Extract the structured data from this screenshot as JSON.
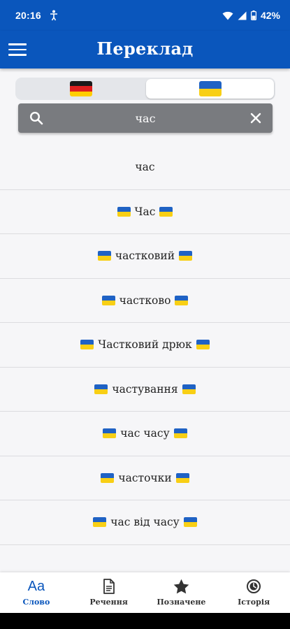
{
  "status_bar": {
    "time": "20:16",
    "battery": "42%"
  },
  "app_bar": {
    "title": "Переклад",
    "menu_icon": "hamburger-menu-icon"
  },
  "language_toggle": {
    "source": {
      "flag": "germany-flag-icon"
    },
    "target": {
      "flag": "ukraine-flag-icon",
      "selected": true
    }
  },
  "search": {
    "value": "час",
    "search_icon": "search-icon",
    "clear_icon": "close-icon"
  },
  "results": [
    {
      "text": "час",
      "flagged": false
    },
    {
      "text": "Час",
      "flagged": true
    },
    {
      "text": "частковий",
      "flagged": true
    },
    {
      "text": "частково",
      "flagged": true
    },
    {
      "text": "Частковий дрюк",
      "flagged": true
    },
    {
      "text": "частування",
      "flagged": true
    },
    {
      "text": "час часу",
      "flagged": true
    },
    {
      "text": "часточки",
      "flagged": true
    },
    {
      "text": "час від часу",
      "flagged": true
    }
  ],
  "bottom_nav": {
    "items": [
      {
        "label": "Слово",
        "icon": "aa-text-icon",
        "glyph": "Aa",
        "active": true
      },
      {
        "label": "Речення",
        "icon": "document-icon",
        "active": false
      },
      {
        "label": "Позначене",
        "icon": "star-icon",
        "active": false
      },
      {
        "label": "Історія",
        "icon": "history-icon",
        "active": false
      }
    ]
  },
  "colors": {
    "primary": "#0a56bc",
    "search_background": "#797b7f",
    "background": "#f6f6f8"
  }
}
